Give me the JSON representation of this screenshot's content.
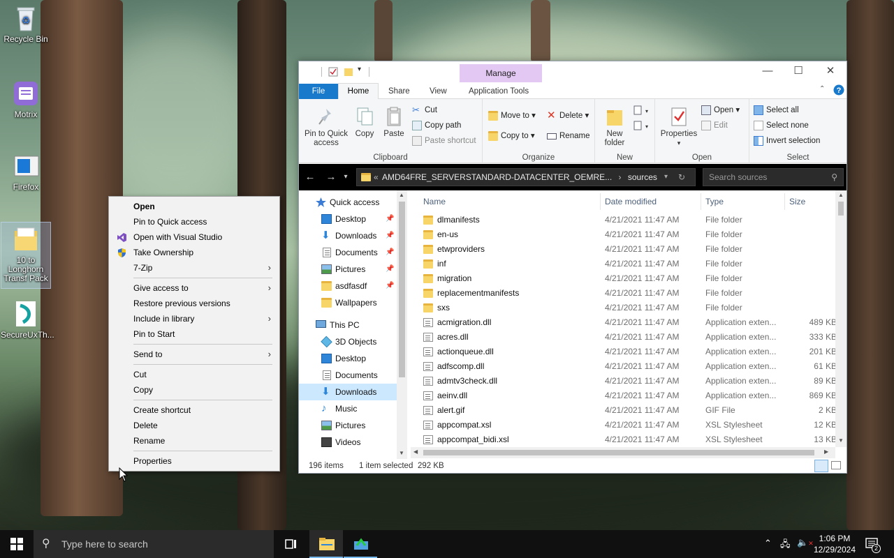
{
  "desktop": {
    "icons": [
      {
        "label": "Recycle Bin"
      },
      {
        "label": "Motrix"
      },
      {
        "label": "Firefox"
      },
      {
        "label": "10 to Longhorn Transf Pack"
      },
      {
        "label": "SecureUxTh..."
      }
    ]
  },
  "context_menu": {
    "items": [
      {
        "label": "Open"
      },
      {
        "label": "Pin to Quick access"
      },
      {
        "label": "Open with Visual Studio"
      },
      {
        "label": "Take Ownership"
      },
      {
        "label": "7-Zip"
      },
      {
        "label": "Give access to"
      },
      {
        "label": "Restore previous versions"
      },
      {
        "label": "Include in library"
      },
      {
        "label": "Pin to Start"
      },
      {
        "label": "Send to"
      },
      {
        "label": "Cut"
      },
      {
        "label": "Copy"
      },
      {
        "label": "Create shortcut"
      },
      {
        "label": "Delete"
      },
      {
        "label": "Rename"
      },
      {
        "label": "Properties"
      }
    ],
    "submenu_arrow": "›"
  },
  "explorer": {
    "manage_label": "Manage",
    "tabs": {
      "file": "File",
      "home": "Home",
      "share": "Share",
      "view": "View",
      "app_tools": "Application Tools"
    },
    "ribbon": {
      "clipboard": {
        "pin": "Pin to Quick access",
        "copy": "Copy",
        "paste": "Paste",
        "cut": "Cut",
        "copy_path": "Copy path",
        "paste_shortcut": "Paste shortcut",
        "label": "Clipboard"
      },
      "organize": {
        "move_to": "Move to",
        "copy_to": "Copy to",
        "delete": "Delete",
        "rename": "Rename",
        "label": "Organize"
      },
      "new": {
        "new_folder": "New folder",
        "label": "New"
      },
      "open": {
        "properties": "Properties",
        "open": "Open",
        "edit": "Edit",
        "label": "Open"
      },
      "select": {
        "select_all": "Select all",
        "select_none": "Select none",
        "invert": "Invert selection",
        "label": "Select"
      }
    },
    "address": {
      "prefix": "«",
      "path": "AMD64FRE_SERVERSTANDARD-DATACENTER_OEMRE...",
      "sep": "›",
      "current": "sources",
      "search_placeholder": "Search sources"
    },
    "nav": [
      {
        "label": "Quick access"
      },
      {
        "label": "Desktop"
      },
      {
        "label": "Downloads"
      },
      {
        "label": "Documents"
      },
      {
        "label": "Pictures"
      },
      {
        "label": "asdfasdf"
      },
      {
        "label": "Wallpapers"
      },
      {
        "label": "This PC"
      },
      {
        "label": "3D Objects"
      },
      {
        "label": "Desktop"
      },
      {
        "label": "Documents"
      },
      {
        "label": "Downloads"
      },
      {
        "label": "Music"
      },
      {
        "label": "Pictures"
      },
      {
        "label": "Videos"
      }
    ],
    "columns": {
      "name": "Name",
      "date": "Date modified",
      "type": "Type",
      "size": "Size"
    },
    "files": [
      {
        "name": "dlmanifests",
        "date": "4/21/2021 11:47 AM",
        "type": "File folder",
        "size": ""
      },
      {
        "name": "en-us",
        "date": "4/21/2021 11:47 AM",
        "type": "File folder",
        "size": ""
      },
      {
        "name": "etwproviders",
        "date": "4/21/2021 11:47 AM",
        "type": "File folder",
        "size": ""
      },
      {
        "name": "inf",
        "date": "4/21/2021 11:47 AM",
        "type": "File folder",
        "size": ""
      },
      {
        "name": "migration",
        "date": "4/21/2021 11:47 AM",
        "type": "File folder",
        "size": ""
      },
      {
        "name": "replacementmanifests",
        "date": "4/21/2021 11:47 AM",
        "type": "File folder",
        "size": ""
      },
      {
        "name": "sxs",
        "date": "4/21/2021 11:47 AM",
        "type": "File folder",
        "size": ""
      },
      {
        "name": "acmigration.dll",
        "date": "4/21/2021 11:47 AM",
        "type": "Application exten...",
        "size": "489 KB"
      },
      {
        "name": "acres.dll",
        "date": "4/21/2021 11:47 AM",
        "type": "Application exten...",
        "size": "333 KB"
      },
      {
        "name": "actionqueue.dll",
        "date": "4/21/2021 11:47 AM",
        "type": "Application exten...",
        "size": "201 KB"
      },
      {
        "name": "adfscomp.dll",
        "date": "4/21/2021 11:47 AM",
        "type": "Application exten...",
        "size": "61 KB"
      },
      {
        "name": "admtv3check.dll",
        "date": "4/21/2021 11:47 AM",
        "type": "Application exten...",
        "size": "89 KB"
      },
      {
        "name": "aeinv.dll",
        "date": "4/21/2021 11:47 AM",
        "type": "Application exten...",
        "size": "869 KB"
      },
      {
        "name": "alert.gif",
        "date": "4/21/2021 11:47 AM",
        "type": "GIF File",
        "size": "2 KB"
      },
      {
        "name": "appcompat.xsl",
        "date": "4/21/2021 11:47 AM",
        "type": "XSL Stylesheet",
        "size": "12 KB"
      },
      {
        "name": "appcompat_bidi.xsl",
        "date": "4/21/2021 11:47 AM",
        "type": "XSL Stylesheet",
        "size": "13 KB"
      }
    ],
    "status": {
      "count": "196 items",
      "selected": "1 item selected",
      "size": "292 KB"
    }
  },
  "taskbar": {
    "search_placeholder": "Type here to search",
    "time": "1:06 PM",
    "date": "12/29/2024",
    "notification_count": "2"
  },
  "colors": {
    "accent": "#1979ca",
    "manage": "#e3c8f3",
    "selection": "#cce8ff"
  }
}
